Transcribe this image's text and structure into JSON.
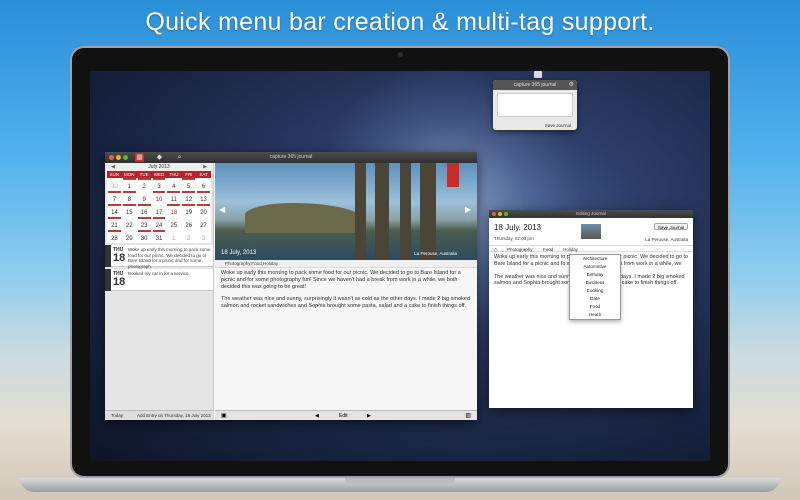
{
  "headline": "Quick menu bar creation & multi-tag support.",
  "colors": {
    "accent_red": "#b7232c",
    "titlebar": "#3a3a3a"
  },
  "menubar_popup": {
    "title": "capture 365 journal",
    "button": "Save Journal",
    "icon": "gear-icon"
  },
  "main_window": {
    "title": "capture 365 journal",
    "toolbar_icons": [
      "calendar-icon",
      "tag-icon",
      "search-icon"
    ],
    "calendar": {
      "month": "July 2013",
      "weekdays": [
        "SUN",
        "MON",
        "TUE",
        "WED",
        "THU",
        "FRI",
        "SAT"
      ],
      "weeks": [
        [
          "30",
          "1",
          "2",
          "3",
          "4",
          "5",
          "6"
        ],
        [
          "7",
          "8",
          "9",
          "10",
          "11",
          "12",
          "13"
        ],
        [
          "14",
          "15",
          "16",
          "17",
          "18",
          "19",
          "20"
        ],
        [
          "21",
          "22",
          "23",
          "24",
          "25",
          "26",
          "27"
        ],
        [
          "28",
          "29",
          "30",
          "31",
          "1",
          "2",
          "3"
        ]
      ]
    },
    "entries": [
      {
        "dow": "THU",
        "day": "18",
        "text": "Woke up early this morning to pack some food for our picnic. We decided to go to Bare Island for a picnic and for some photograph."
      },
      {
        "dow": "THU",
        "day": "18",
        "text": "Booked my car in for a service."
      }
    ],
    "left_bar": {
      "today": "Today",
      "add": "Add Entry on Thursday, 18 July 2013"
    },
    "photo_caption": "18 July, 2013",
    "photo_location": "La Perouse, Australia",
    "tags_line": "Photography,Food,Holiday",
    "body": [
      "Woke up early this morning to pack some food for our picnic. We decided to go to Bare Island for a picnic and for some photography fun! Since we haven't had a break from work in a while, we both decided this was going to be great!",
      "The weather was nice and sunny, surprisingly it wasn't as cold as the other days. I made 2 big smoked salmon and rocket sandwiches and Sophia brought some pasta, salad and a cake to finish things off."
    ],
    "bottom_bar": {
      "edit": "Edit",
      "prev": "◀",
      "next": "▶"
    }
  },
  "editing_window": {
    "title": "Editing Journal",
    "date": "18 July, 2013",
    "time": "Thursday, 02:08 pm",
    "save": "Save Journal",
    "location": "La Perouse, Australia",
    "tags": [
      "Photography",
      "Food",
      "Holiday"
    ],
    "body": [
      "Woke up early this morning to pack some food for our picnic. We decided to go to Bare Island for a picnic and fo we haven't had a break from work in a while, we",
      "The weather was nice and sunny, surprisin the other days. I made 2 big smoked salmon and Sophia brought some pasta, salad and a cake to finish things off."
    ],
    "dropdown": [
      "Architecture",
      "Automotive",
      "Birthday",
      "Business",
      "Cooking",
      "Date",
      "Food",
      "Heath"
    ]
  }
}
